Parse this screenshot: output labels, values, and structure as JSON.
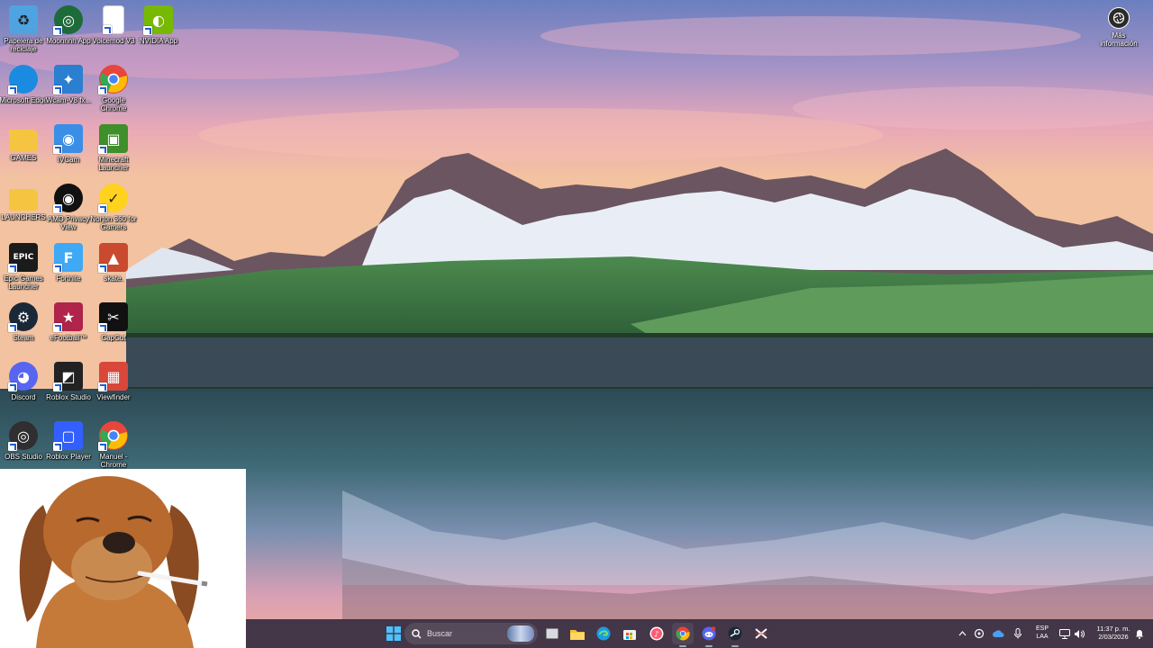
{
  "desktop": {
    "icons": [
      {
        "label": "Papelera de reciclaje",
        "icon": "recycle-bin-icon",
        "color": "#4fa3e0"
      },
      {
        "label": "Moonrinh App",
        "icon": "moonrinh-icon",
        "color": "#1e6b3a"
      },
      {
        "label": "Voicemod V3",
        "icon": "document-icon",
        "color": "#ffffff"
      },
      {
        "label": "NVIDIA App",
        "icon": "nvidia-icon",
        "color": "#76b900"
      },
      {
        "label": "Microsoft Edge",
        "icon": "edge-icon",
        "color": "#1a8be0"
      },
      {
        "label": "Wcam-V8 fx...",
        "icon": "wcam-icon",
        "color": "#2a7fd0"
      },
      {
        "label": "Google Chrome",
        "icon": "chrome-icon",
        "color": "#e8453c"
      },
      {
        "label": "GAMES",
        "icon": "folder-icon",
        "color": "#f5c542"
      },
      {
        "label": "IVCam",
        "icon": "ivcam-icon",
        "color": "#3a8ee6"
      },
      {
        "label": "Minecraft Launcher",
        "icon": "minecraft-icon",
        "color": "#3f8f2a"
      },
      {
        "label": "LAUNCHERS",
        "icon": "folder-icon",
        "color": "#f5c542"
      },
      {
        "label": "AMD Privacy View",
        "icon": "eye-icon",
        "color": "#111111"
      },
      {
        "label": "Norton 360 for Gamers",
        "icon": "norton-icon",
        "color": "#ffd21e"
      },
      {
        "label": "Epic Games Launcher",
        "icon": "epic-games-icon",
        "color": "#1b1b1b"
      },
      {
        "label": "Fortnite",
        "icon": "fortnite-icon",
        "color": "#3fa9f5"
      },
      {
        "label": "skate.",
        "icon": "skate-icon",
        "color": "#c94a2e"
      },
      {
        "label": "Steam",
        "icon": "steam-icon",
        "color": "#1b2838"
      },
      {
        "label": "eFootball™",
        "icon": "efootball-icon",
        "color": "#b0234b"
      },
      {
        "label": "CapCut",
        "icon": "capcut-icon",
        "color": "#111111"
      },
      {
        "label": "Discord",
        "icon": "discord-icon",
        "color": "#5865f2"
      },
      {
        "label": "Roblox Studio",
        "icon": "roblox-studio-icon",
        "color": "#222222"
      },
      {
        "label": "Viewfinder",
        "icon": "viewfinder-icon",
        "color": "#d9473b"
      },
      {
        "label": "OBS Studio",
        "icon": "obs-icon",
        "color": "#302e31"
      },
      {
        "label": "Roblox Player",
        "icon": "roblox-icon",
        "color": "#335fff"
      },
      {
        "label": "Manuel - Chrome",
        "icon": "chrome-icon",
        "color": "#e8453c"
      }
    ],
    "info_label": "Más información"
  },
  "taskbar": {
    "search_placeholder": "Buscar",
    "apps": [
      {
        "icon": "windows-start-icon"
      },
      {
        "icon": "search-icon"
      },
      {
        "icon": "task-view-icon"
      },
      {
        "icon": "file-explorer-icon"
      },
      {
        "icon": "edge-icon"
      },
      {
        "icon": "microsoft-store-icon"
      },
      {
        "icon": "itunes-icon"
      },
      {
        "icon": "chrome-icon"
      },
      {
        "icon": "discord-icon"
      },
      {
        "icon": "steam-icon"
      },
      {
        "icon": "capcut-icon"
      }
    ],
    "tray": {
      "language_1": "ESP",
      "language_2": "LAA",
      "time": "11:37 p. m.",
      "date": "2/03/2026"
    }
  }
}
